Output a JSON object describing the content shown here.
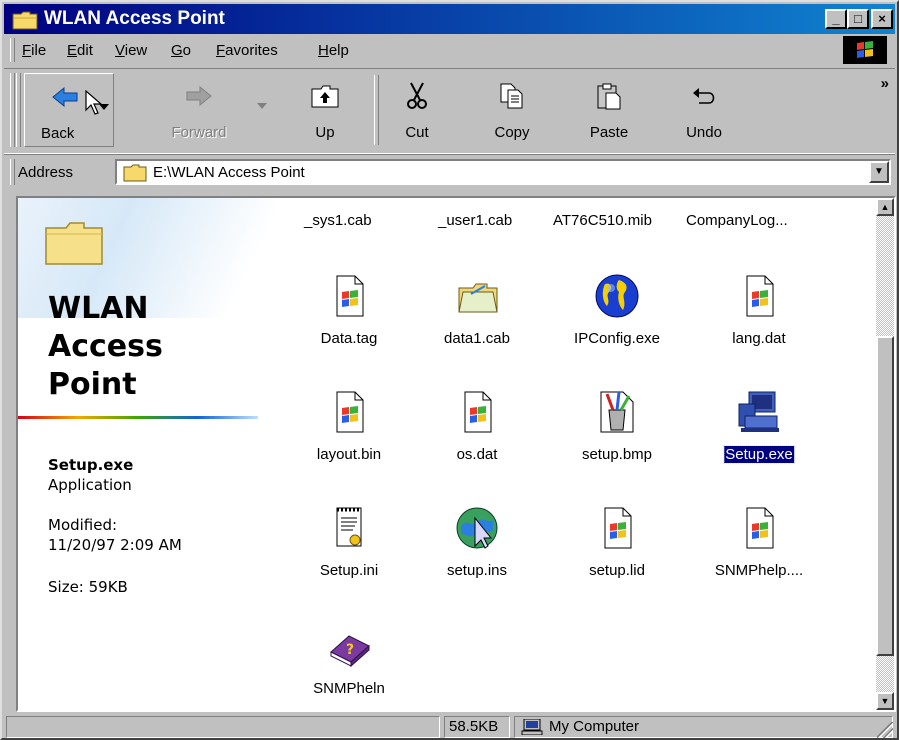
{
  "window": {
    "title": "WLAN Access Point",
    "minimize_glyph": "_",
    "maximize_glyph": "□",
    "close_glyph": "×"
  },
  "menu": [
    "File",
    "Edit",
    "View",
    "Go",
    "Favorites",
    "Help"
  ],
  "toolbar": {
    "back": "Back",
    "forward": "Forward",
    "up": "Up",
    "cut": "Cut",
    "copy": "Copy",
    "paste": "Paste",
    "undo": "Undo",
    "more": "»"
  },
  "address": {
    "label": "Address",
    "value": "E:\\WLAN Access Point"
  },
  "info_pane": {
    "title_line1": "WLAN",
    "title_line2": "Access",
    "title_line3": "Point",
    "selected_name": "Setup.exe",
    "selected_type": "Application",
    "modified_label": "Modified:",
    "modified_value": "11/20/97 2:09 AM",
    "size": "Size: 59KB"
  },
  "files": {
    "top_row": [
      "_sys1.cab",
      "_user1.cab",
      "AT76C510.mib",
      "CompanyLog..."
    ],
    "row1": [
      "Data.tag",
      "data1.cab",
      "IPConfig.exe",
      "lang.dat"
    ],
    "row2": [
      "layout.bin",
      "os.dat",
      "setup.bmp",
      "Setup.exe"
    ],
    "row3": [
      "Setup.ini",
      "setup.ins",
      "setup.lid",
      "SNMPhelp...."
    ],
    "row4": [
      "SNMPheln"
    ]
  },
  "selected_file": "Setup.exe",
  "status": {
    "size": "58.5KB",
    "zone": "My Computer"
  }
}
